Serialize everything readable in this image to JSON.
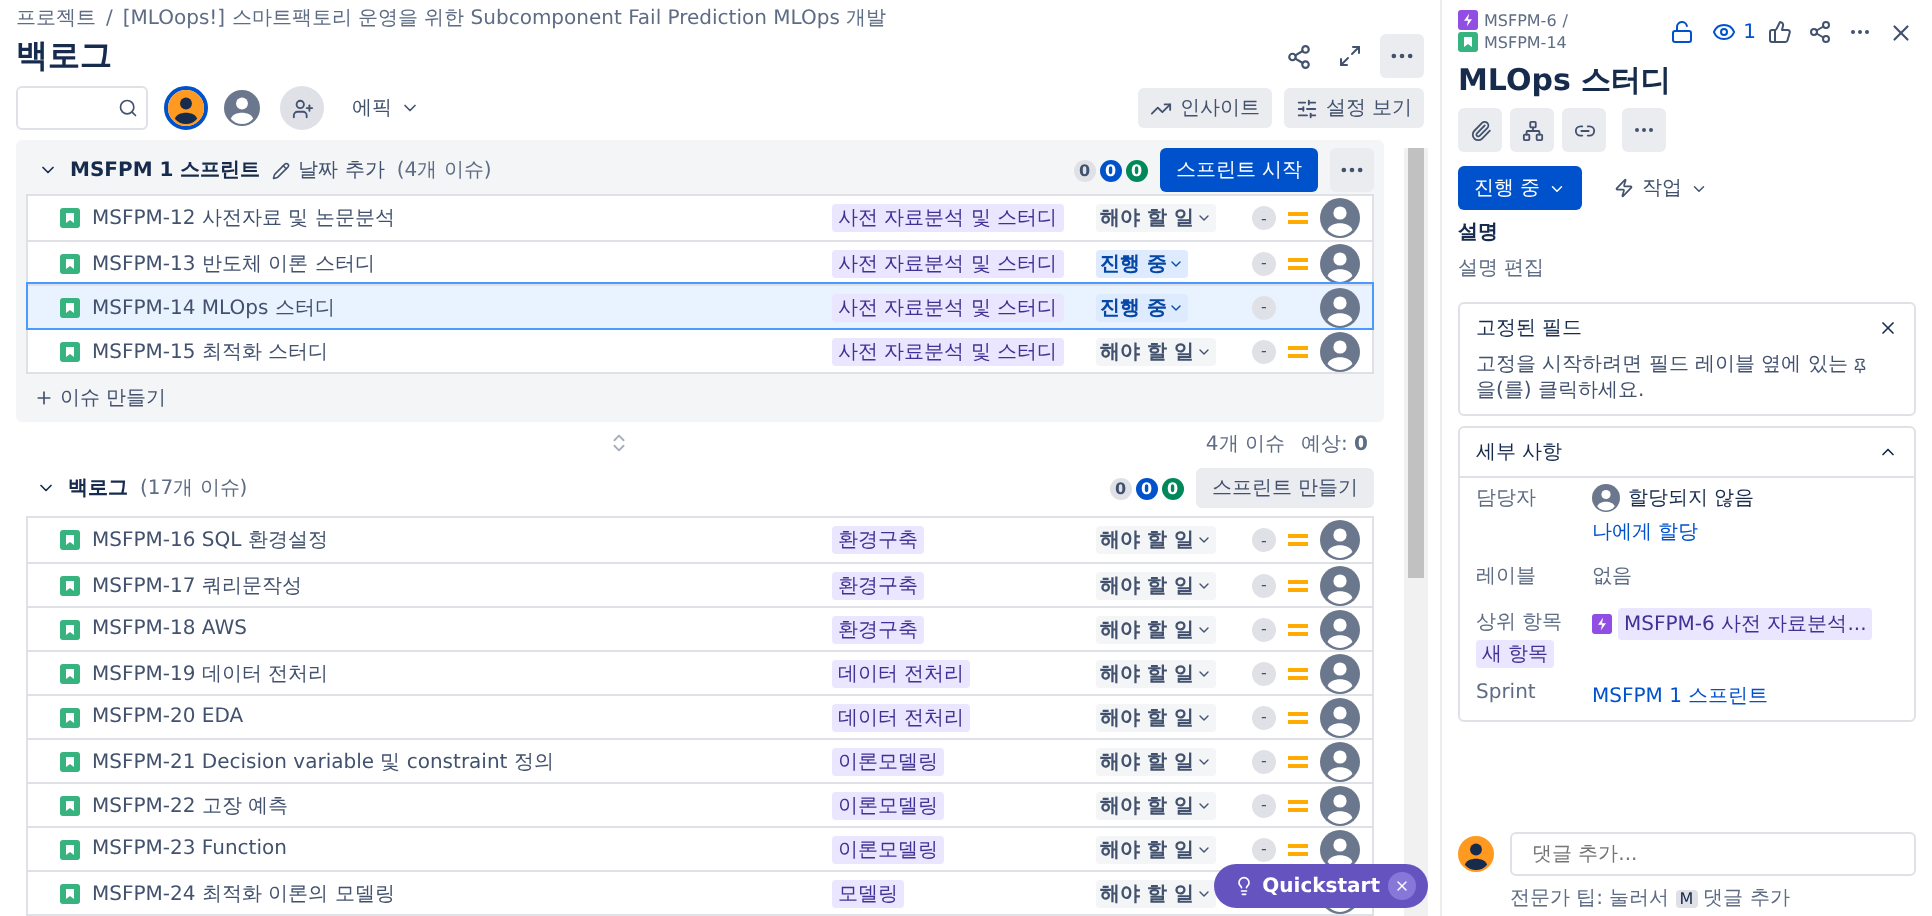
{
  "breadcrumbs": [
    "프로젝트",
    "[MLOops!] 스마트팩토리 운영을 위한 Subcomponent Fail Prediction MLOps 개발"
  ],
  "breadcrumb_separator": "/",
  "page_title": "백로그",
  "toolbar": {
    "avatars": [
      {
        "selected": true
      },
      {
        "selected": false
      }
    ],
    "epic_filter": "에픽",
    "insights_button": "인사이트",
    "view_settings_button": "설정 보기"
  },
  "sprint": {
    "title": "MSFPM 1 스프린트",
    "date_action": "날짜 추가",
    "issue_count": "(4개 이슈)",
    "counts": [
      {
        "value": "0",
        "color": "#dfe1e6"
      },
      {
        "value": "0",
        "color": "#0052cc"
      },
      {
        "value": "0",
        "color": "#00875a"
      }
    ],
    "start_button": "스프린트 시작",
    "issues": [
      {
        "key": "MSFPM-12",
        "summary": "사전자료 및 논문분석",
        "epic": "사전 자료분석 및 스터디",
        "status": "해야 할 일",
        "in_progress": false,
        "estimate": "-",
        "medium_priority": true,
        "selected": false
      },
      {
        "key": "MSFPM-13",
        "summary": "반도체 이론 스터디",
        "epic": "사전 자료분석 및 스터디",
        "status": "진행 중",
        "in_progress": true,
        "estimate": "-",
        "medium_priority": true,
        "selected": false
      },
      {
        "key": "MSFPM-14",
        "summary": "MLOps 스터디",
        "epic": "사전 자료분석 및 스터디",
        "status": "진행 중",
        "in_progress": true,
        "estimate": "-",
        "medium_priority": false,
        "selected": true
      },
      {
        "key": "MSFPM-15",
        "summary": "최적화 스터디",
        "epic": "사전 자료분석 및 스터디",
        "status": "해야 할 일",
        "in_progress": false,
        "estimate": "-",
        "medium_priority": true,
        "selected": false
      }
    ],
    "create_issue": "이슈 만들기"
  },
  "sprint_summary": {
    "issues": "4개 이슈",
    "estimate_label": "예상:",
    "estimate_value": "0"
  },
  "backlog": {
    "title": "백로그",
    "issue_count": "(17개 이슈)",
    "counts": [
      {
        "value": "0",
        "color": "#dfe1e6"
      },
      {
        "value": "0",
        "color": "#0052cc"
      },
      {
        "value": "0",
        "color": "#00875a"
      }
    ],
    "create_sprint_button": "스프린트 만들기",
    "issues": [
      {
        "key": "MSFPM-16",
        "summary": "SQL 환경설정",
        "epic": "환경구축",
        "status": "해야 할 일",
        "in_progress": false,
        "estimate": "-",
        "medium_priority": true,
        "selected": false
      },
      {
        "key": "MSFPM-17",
        "summary": "쿼리문작성",
        "epic": "환경구축",
        "status": "해야 할 일",
        "in_progress": false,
        "estimate": "-",
        "medium_priority": true,
        "selected": false
      },
      {
        "key": "MSFPM-18",
        "summary": "AWS",
        "epic": "환경구축",
        "status": "해야 할 일",
        "in_progress": false,
        "estimate": "-",
        "medium_priority": true,
        "selected": false
      },
      {
        "key": "MSFPM-19",
        "summary": "데이터 전처리",
        "epic": "데이터 전처리",
        "status": "해야 할 일",
        "in_progress": false,
        "estimate": "-",
        "medium_priority": true,
        "selected": false
      },
      {
        "key": "MSFPM-20",
        "summary": "EDA",
        "epic": "데이터 전처리",
        "status": "해야 할 일",
        "in_progress": false,
        "estimate": "-",
        "medium_priority": true,
        "selected": false
      },
      {
        "key": "MSFPM-21",
        "summary": "Decision variable 및 constraint 정의",
        "epic": "이론모델링",
        "status": "해야 할 일",
        "in_progress": false,
        "estimate": "-",
        "medium_priority": true,
        "selected": false
      },
      {
        "key": "MSFPM-22",
        "summary": "고장 예측",
        "epic": "이론모델링",
        "status": "해야 할 일",
        "in_progress": false,
        "estimate": "-",
        "medium_priority": true,
        "selected": false
      },
      {
        "key": "MSFPM-23",
        "summary": "Function",
        "epic": "이론모델링",
        "status": "해야 할 일",
        "in_progress": false,
        "estimate": "-",
        "medium_priority": true,
        "selected": false
      },
      {
        "key": "MSFPM-24",
        "summary": "최적화 이론의 모델링",
        "epic": "모델링",
        "status": "해야 할 일",
        "in_progress": false,
        "selected": false
      }
    ]
  },
  "quickstart": {
    "label": "Quickstart"
  },
  "detail": {
    "parent_key": "MSFPM-6",
    "parent_separator": "/",
    "issue_key": "MSFPM-14",
    "watchers": "1",
    "title": "MLOps 스터디",
    "status_button": "진행 중",
    "action_button": "작업",
    "description_label": "설명",
    "description_placeholder": "설명 편집",
    "pinned": {
      "title": "고정된 필드",
      "text_before": "고정을 시작하려면 필드 레이블 옆에 있는",
      "text_after": "을(를) 클릭하세요."
    },
    "details": {
      "title": "세부 사항",
      "expanded": true,
      "assignee_label": "담당자",
      "assignee": "할당되지 않음",
      "assign_me": "나에게 할당",
      "labels_label": "레이블",
      "labels_value": "없음",
      "parent_label": "상위 항목",
      "parent_badge": "새 항목",
      "parent_value": "MSFPM-6 사전 자료분석...",
      "sprint_label": "Sprint",
      "sprint_value": "MSFPM 1 스프린트"
    },
    "comment": {
      "placeholder": "댓글 추가...",
      "tip_before": "전문가 팁: 눌러서",
      "tip_key": "M",
      "tip_after": "댓글 추가"
    }
  }
}
